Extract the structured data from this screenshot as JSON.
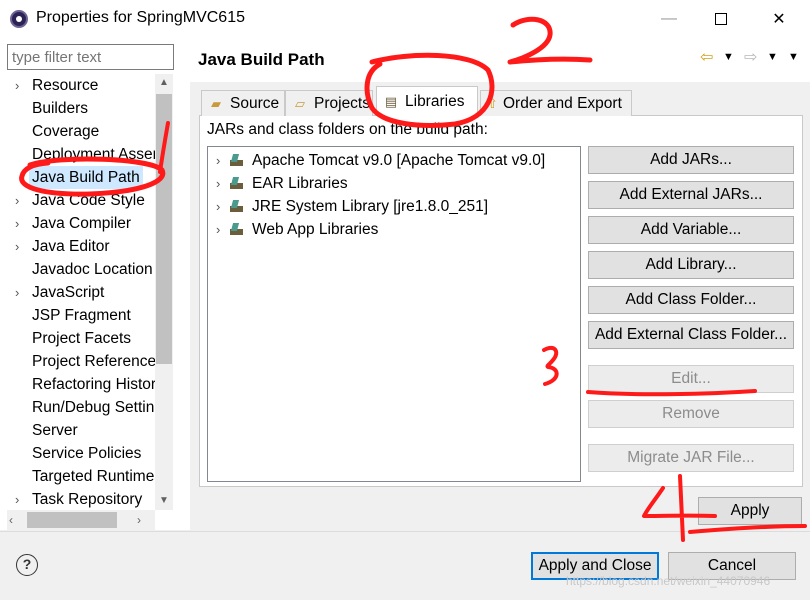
{
  "window": {
    "title": "Properties for SpringMVC615",
    "minimize_glyph": "—",
    "close_glyph": "✕"
  },
  "filter": {
    "placeholder": "type filter text"
  },
  "tree": {
    "items": [
      {
        "label": "Resource",
        "chevron": "›",
        "selected": false
      },
      {
        "label": "Builders",
        "chevron": "",
        "selected": false
      },
      {
        "label": "Coverage",
        "chevron": "",
        "selected": false
      },
      {
        "label": "Deployment Assembly",
        "chevron": "",
        "selected": false
      },
      {
        "label": "Java Build Path",
        "chevron": "",
        "selected": true
      },
      {
        "label": "Java Code Style",
        "chevron": "›",
        "selected": false
      },
      {
        "label": "Java Compiler",
        "chevron": "›",
        "selected": false
      },
      {
        "label": "Java Editor",
        "chevron": "›",
        "selected": false
      },
      {
        "label": "Javadoc Location",
        "chevron": "",
        "selected": false
      },
      {
        "label": "JavaScript",
        "chevron": "›",
        "selected": false
      },
      {
        "label": "JSP Fragment",
        "chevron": "",
        "selected": false
      },
      {
        "label": "Project Facets",
        "chevron": "",
        "selected": false
      },
      {
        "label": "Project References",
        "chevron": "",
        "selected": false
      },
      {
        "label": "Refactoring History",
        "chevron": "",
        "selected": false
      },
      {
        "label": "Run/Debug Settings",
        "chevron": "",
        "selected": false
      },
      {
        "label": "Server",
        "chevron": "",
        "selected": false
      },
      {
        "label": "Service Policies",
        "chevron": "",
        "selected": false
      },
      {
        "label": "Targeted Runtimes",
        "chevron": "",
        "selected": false
      },
      {
        "label": "Task Repository",
        "chevron": "›",
        "selected": false
      }
    ]
  },
  "page": {
    "title": "Java Build Path"
  },
  "tabs": [
    {
      "label": "Source",
      "icon": "source-folder-icon"
    },
    {
      "label": "Projects",
      "icon": "project-folder-icon"
    },
    {
      "label": "Libraries",
      "icon": "libraries-icon"
    },
    {
      "label": "Order and Export",
      "icon": "order-export-icon"
    }
  ],
  "panel": {
    "label": "JARs and class folders on the build path:"
  },
  "libraries": [
    {
      "label": "Apache Tomcat v9.0 [Apache Tomcat v9.0]"
    },
    {
      "label": "EAR Libraries"
    },
    {
      "label": "JRE System Library [jre1.8.0_251]"
    },
    {
      "label": "Web App Libraries"
    }
  ],
  "buttons": {
    "add_jars": "Add JARs...",
    "add_external_jars": "Add External JARs...",
    "add_variable": "Add Variable...",
    "add_library": "Add Library...",
    "add_class_folder": "Add Class Folder...",
    "add_external_class_folder": "Add External Class Folder...",
    "edit": "Edit...",
    "remove": "Remove",
    "migrate_jar": "Migrate JAR File...",
    "apply": "Apply",
    "apply_and_close": "Apply and Close",
    "cancel": "Cancel"
  },
  "help": {
    "glyph": "?"
  },
  "watermark": "https://blog.csdn.net/weixin_44070946",
  "annotations": {
    "color": "#ff1a1a",
    "labels": [
      "1",
      "2",
      "3",
      "4"
    ]
  }
}
